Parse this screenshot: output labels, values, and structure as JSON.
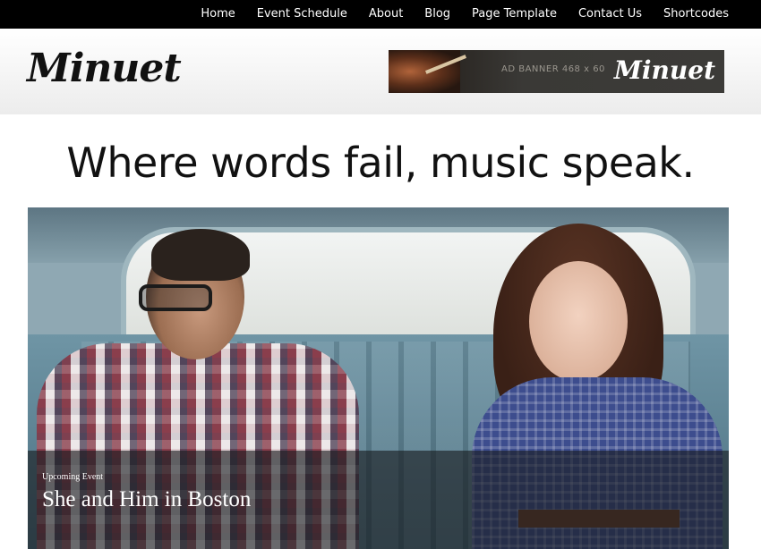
{
  "nav": {
    "items": [
      {
        "label": "Home"
      },
      {
        "label": "Event Schedule"
      },
      {
        "label": "About"
      },
      {
        "label": "Blog"
      },
      {
        "label": "Page Template"
      },
      {
        "label": "Contact Us"
      },
      {
        "label": "Shortcodes"
      }
    ]
  },
  "header": {
    "logo_text": "Minuet",
    "ad_banner": {
      "text": "AD BANNER 468 x 60",
      "logo_text": "Minuet"
    }
  },
  "tagline": "Where words fail, music speak.",
  "featured": {
    "label": "Upcoming Event",
    "title": "She and Him in Boston"
  }
}
